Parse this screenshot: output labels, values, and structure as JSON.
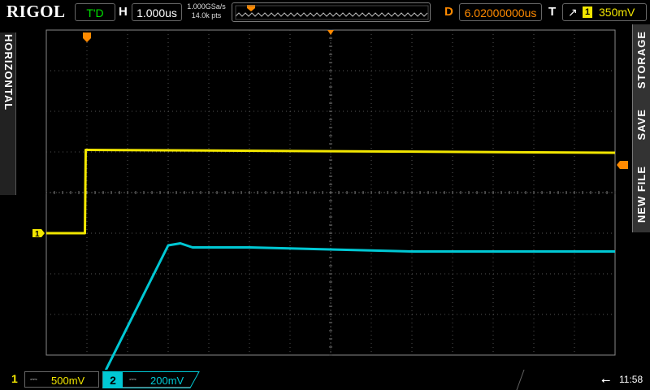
{
  "brand": "RIGOL",
  "run_state": "T'D",
  "horizontal": {
    "key": "H",
    "timebase": "1.000us"
  },
  "acquisition": {
    "sample_rate": "1.000GSa/s",
    "memory_depth": "14.0k pts"
  },
  "delay": {
    "key": "D",
    "value": "6.02000000us"
  },
  "trigger": {
    "key": "T",
    "edge": "rising-edge-icon",
    "source": "1",
    "level": "350mV"
  },
  "left_panel": {
    "label": "HORIZONTAL"
  },
  "right_panel": {
    "labels": [
      "STORAGE",
      "SAVE",
      "NEW FILE"
    ]
  },
  "channels": [
    {
      "number": "1",
      "coupling": "⎓",
      "scale": "500mV",
      "color": "#f2e600"
    },
    {
      "number": "2",
      "coupling": "⎓",
      "scale": "200mV",
      "color": "#00c8d4"
    }
  ],
  "status": {
    "usb": "usb-icon",
    "time": "11:58"
  },
  "colors": {
    "ch1": "#f2e600",
    "ch2": "#00c8d4",
    "trigger": "#ff8a00",
    "grid": "#555555"
  },
  "chart_data": {
    "type": "line",
    "grid": {
      "divisions_x": 14,
      "divisions_y": 8
    },
    "x_units": "div",
    "series": [
      {
        "channel": "1",
        "x": [
          0,
          0.95,
          0.97,
          1.0,
          14.0
        ],
        "y": [
          -1.0,
          -1.0,
          1.05,
          1.05,
          0.98
        ]
      },
      {
        "channel": "2",
        "x": [
          0,
          1.1,
          1.2,
          3.0,
          3.3,
          3.6,
          5.0,
          9.0,
          14.0
        ],
        "y": [
          -5.0,
          -5.0,
          -4.9,
          -1.3,
          -1.25,
          -1.35,
          -1.35,
          -1.45,
          -1.45
        ]
      }
    ],
    "trigger_marker_x_div": 1.0,
    "trigger_level_div": 1.0
  }
}
